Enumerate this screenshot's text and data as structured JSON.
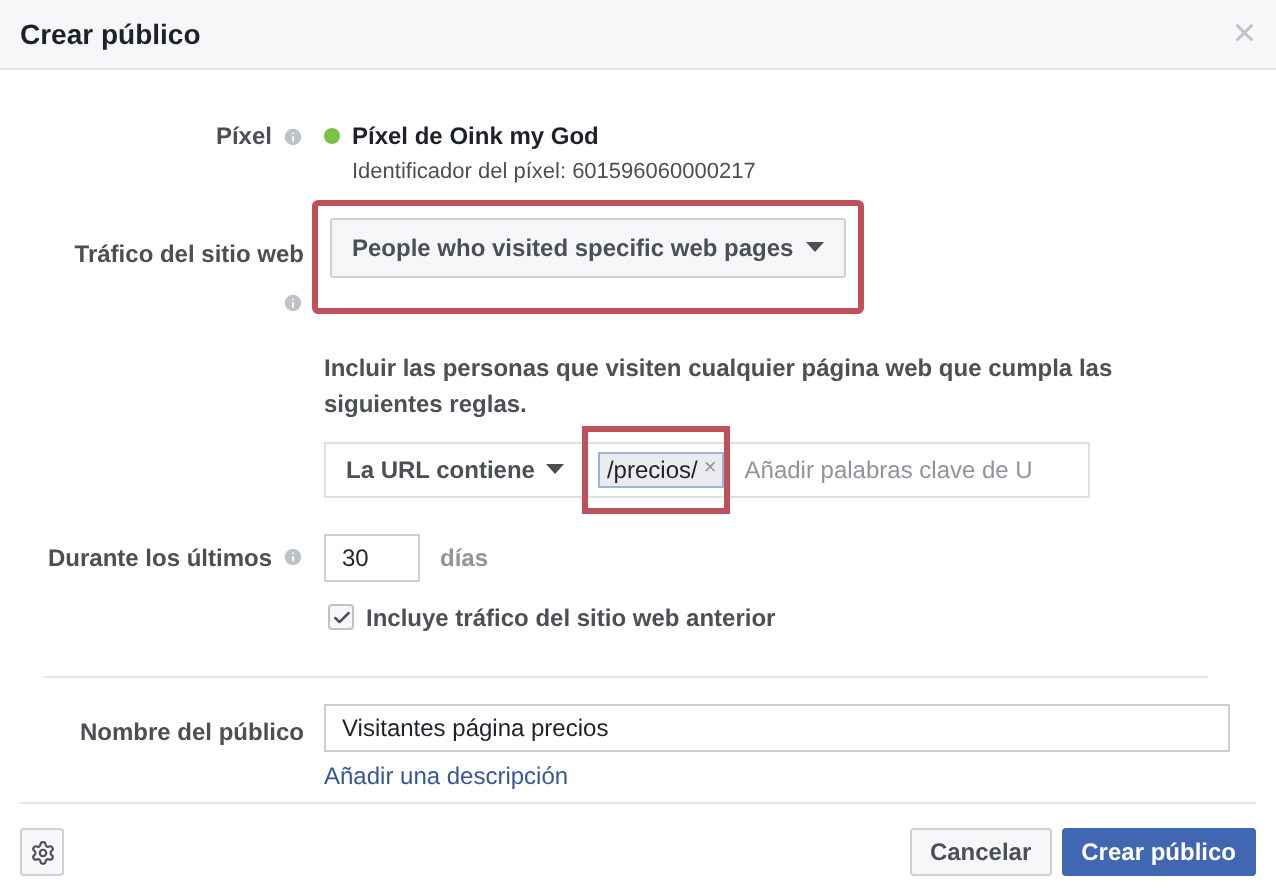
{
  "dialog": {
    "title": "Crear público",
    "close": "×"
  },
  "pixel": {
    "label": "Píxel",
    "color": "#7ac142",
    "name": "Píxel de Oink my God",
    "id_text": "Identificador del píxel: 601596060000217"
  },
  "traffic": {
    "label": "Tráfico del sitio web",
    "dropdown": "People who visited specific web pages"
  },
  "rules": {
    "instruction": "Incluir las personas que visiten cualquier página web que cumpla las siguientes reglas.",
    "condition": "La URL contiene",
    "tags": [
      {
        "text": "/precios/",
        "remove": "×"
      }
    ],
    "placeholder": "Añadir palabras clave de U"
  },
  "duration": {
    "label": "Durante los últimos",
    "value": "30",
    "unit": "días"
  },
  "include_past": {
    "label": "Incluye tráfico del sitio web anterior",
    "checked": true
  },
  "audience_name": {
    "label": "Nombre del público",
    "value": "Visitantes página precios",
    "link": "Añadir una descripción"
  },
  "buttons": [
    {
      "label": "Cancelar",
      "kind": "secondary"
    },
    {
      "label": "Crear público",
      "kind": "primary"
    }
  ]
}
